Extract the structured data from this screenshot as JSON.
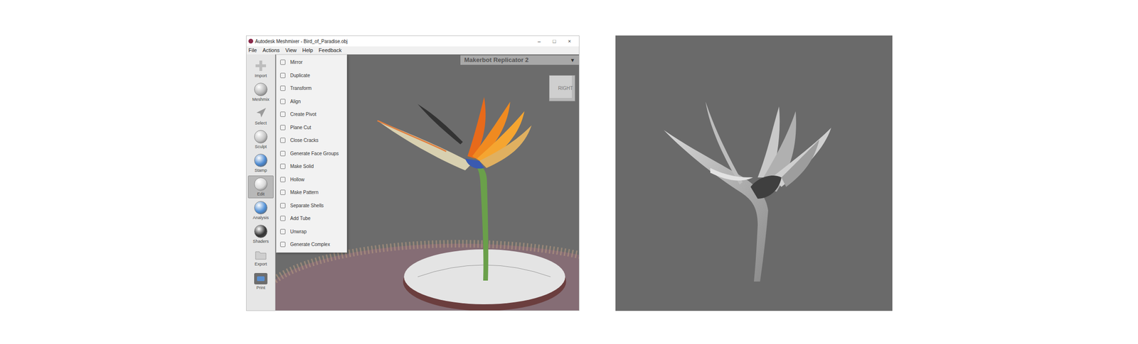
{
  "window": {
    "title": "Autodesk Meshmixer - Bird_of_Paradise.obj",
    "controls": [
      "–",
      "□",
      "×"
    ]
  },
  "menu_bar": [
    "File",
    "Actions",
    "View",
    "Help",
    "Feedback"
  ],
  "tools": [
    {
      "label": "Import",
      "selected": false
    },
    {
      "label": "Meshmix",
      "selected": false
    },
    {
      "label": "Select",
      "selected": false
    },
    {
      "label": "Sculpt",
      "selected": false
    },
    {
      "label": "Stamp",
      "selected": false
    },
    {
      "label": "Edit",
      "selected": true
    },
    {
      "label": "Analysis",
      "selected": false
    },
    {
      "label": "Shaders",
      "selected": false
    },
    {
      "label": "Export",
      "selected": false
    },
    {
      "label": "Print",
      "selected": false
    }
  ],
  "edit_menu": [
    "Mirror",
    "Duplicate",
    "Transform",
    "Align",
    "Create Pivot",
    "Plane Cut",
    "Close Cracks",
    "Generate Face Groups",
    "Make Solid",
    "Hollow",
    "Make Pattern",
    "Separate Shells",
    "Add Tube",
    "Unwrap",
    "Generate Complex"
  ],
  "printer": {
    "label": "Makerbot Replicator 2",
    "arrow": "▼"
  },
  "view_cube": {
    "label": "RIGHT"
  }
}
